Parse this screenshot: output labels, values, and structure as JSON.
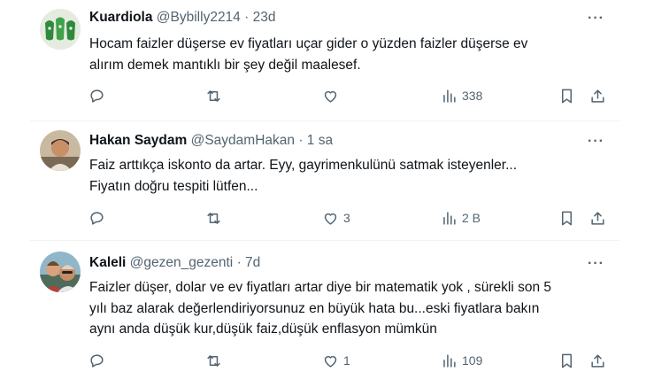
{
  "tweets": [
    {
      "name": "Kuardiola",
      "handle": "@Bybilly2214",
      "separator": "·",
      "time": "23d",
      "text_lines": [
        "Hocam faizler düşerse ev fiyatları uçar gider o yüzden faizler düşerse ev",
        "alırım demek mantıklı bir şey değil maalesef."
      ],
      "replies": "",
      "retweets": "",
      "likes": "",
      "views": "338"
    },
    {
      "name": "Hakan Saydam",
      "handle": "@SaydamHakan",
      "separator": "·",
      "time": "1 sa",
      "text_lines": [
        "Faiz arttıkça iskonto da artar. Eyy, gayrimenkulünü satmak isteyenler...",
        "Fiyatın doğru tespiti lütfen..."
      ],
      "replies": "",
      "retweets": "",
      "likes": "3",
      "views": "2 B"
    },
    {
      "name": "Kaleli",
      "handle": "@gezen_gezenti",
      "separator": "·",
      "time": "7d",
      "text_lines": [
        "Faizler düşer, dolar ve ev fiyatları artar diye bir matematik yok , sürekli son 5",
        "yılı baz alarak değerlendiriyorsunuz en büyük hata bu...eski fiyatlara bakın",
        "aynı anda düşük kur,düşük faiz,düşük enflasyon mümkün"
      ],
      "replies": "",
      "retweets": "",
      "likes": "1",
      "views": "109"
    }
  ],
  "more_glyph": "···",
  "icons": [
    "reply-icon",
    "retweet-icon",
    "like-icon",
    "views-icon",
    "bookmark-icon",
    "share-icon",
    "more-icon"
  ]
}
